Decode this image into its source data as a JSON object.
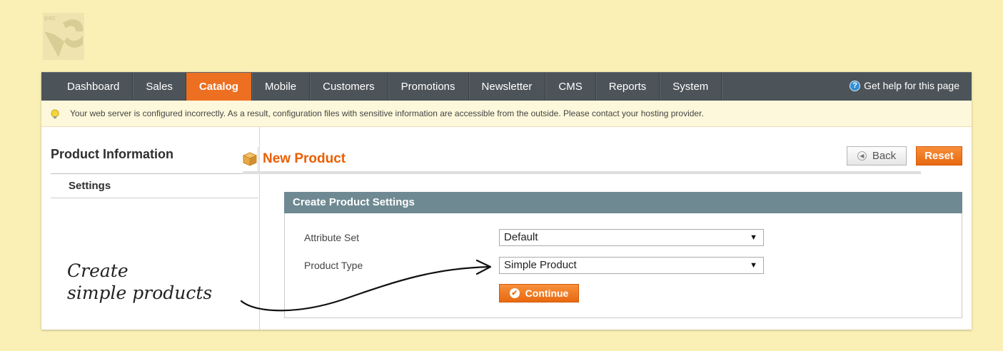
{
  "nav": {
    "items": [
      "Dashboard",
      "Sales",
      "Catalog",
      "Mobile",
      "Customers",
      "Promotions",
      "Newsletter",
      "CMS",
      "Reports",
      "System"
    ],
    "active": "Catalog",
    "help_label": "Get help for this page"
  },
  "notice": {
    "text": "Your web server is configured incorrectly. As a result, configuration files with sensitive information are accessible from the outside. Please contact your hosting provider."
  },
  "sidebar": {
    "title": "Product Information",
    "tab": "Settings"
  },
  "page": {
    "title": "New Product",
    "back_label": "Back",
    "reset_label": "Reset"
  },
  "form": {
    "header": "Create Product Settings",
    "attribute_set_label": "Attribute Set",
    "attribute_set_value": "Default",
    "product_type_label": "Product Type",
    "product_type_value": "Simple Product",
    "continue_label": "Continue"
  },
  "annotation": {
    "line1": "Create",
    "line2": "simple products"
  },
  "colors": {
    "accent": "#ec6f22",
    "nav_bg": "#4d5459",
    "fieldset_header": "#6f8992",
    "page_bg": "#faf0b6"
  }
}
